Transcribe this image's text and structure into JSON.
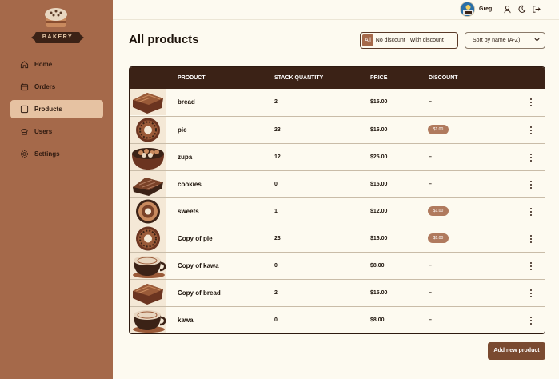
{
  "brand": {
    "name": "BAKERY"
  },
  "sidebar": {
    "items": [
      {
        "label": "Home",
        "icon": "home-icon"
      },
      {
        "label": "Orders",
        "icon": "orders-icon"
      },
      {
        "label": "Products",
        "icon": "products-icon"
      },
      {
        "label": "Users",
        "icon": "users-icon"
      },
      {
        "label": "Settings",
        "icon": "gear-icon"
      }
    ],
    "active": "Products"
  },
  "topbar": {
    "username": "Greg"
  },
  "page": {
    "title": "All products"
  },
  "filters": {
    "options": [
      "All",
      "No discount",
      "With discount"
    ],
    "selected": "All"
  },
  "sort": {
    "selected": "Sort by name (A-Z)"
  },
  "table": {
    "headers": {
      "product": "PRODUCT",
      "quantity": "STACK QUANTITY",
      "price": "PRICE",
      "discount": "DISCOUNT"
    },
    "rows": [
      {
        "name": "bread",
        "quantity": "2",
        "price": "$15.00",
        "discount": "–",
        "image": "bread"
      },
      {
        "name": "pie",
        "quantity": "23",
        "price": "$16.00",
        "discount": "$1.00",
        "image": "donut"
      },
      {
        "name": "zupa",
        "quantity": "12",
        "price": "$25.00",
        "discount": "–",
        "image": "bowl"
      },
      {
        "name": "cookies",
        "quantity": "0",
        "price": "$15.00",
        "discount": "–",
        "image": "cookies"
      },
      {
        "name": "sweets",
        "quantity": "1",
        "price": "$12.00",
        "discount": "$1.00",
        "image": "sweets"
      },
      {
        "name": "Copy of pie",
        "quantity": "23",
        "price": "$16.00",
        "discount": "$1.00",
        "image": "donut"
      },
      {
        "name": "Copy of kawa",
        "quantity": "0",
        "price": "$8.00",
        "discount": "–",
        "image": "coffee"
      },
      {
        "name": "Copy of bread",
        "quantity": "2",
        "price": "$15.00",
        "discount": "–",
        "image": "bread"
      },
      {
        "name": "kawa",
        "quantity": "0",
        "price": "$8.00",
        "discount": "–",
        "image": "coffee"
      }
    ]
  },
  "actions": {
    "add_label": "Add new product"
  },
  "colors": {
    "sidebar": "#a5694a",
    "header": "#3b2216",
    "active_nav": "#e6c2a2",
    "badge": "#b07a5e",
    "button": "#7a4a30",
    "background": "#fdfaf0"
  }
}
